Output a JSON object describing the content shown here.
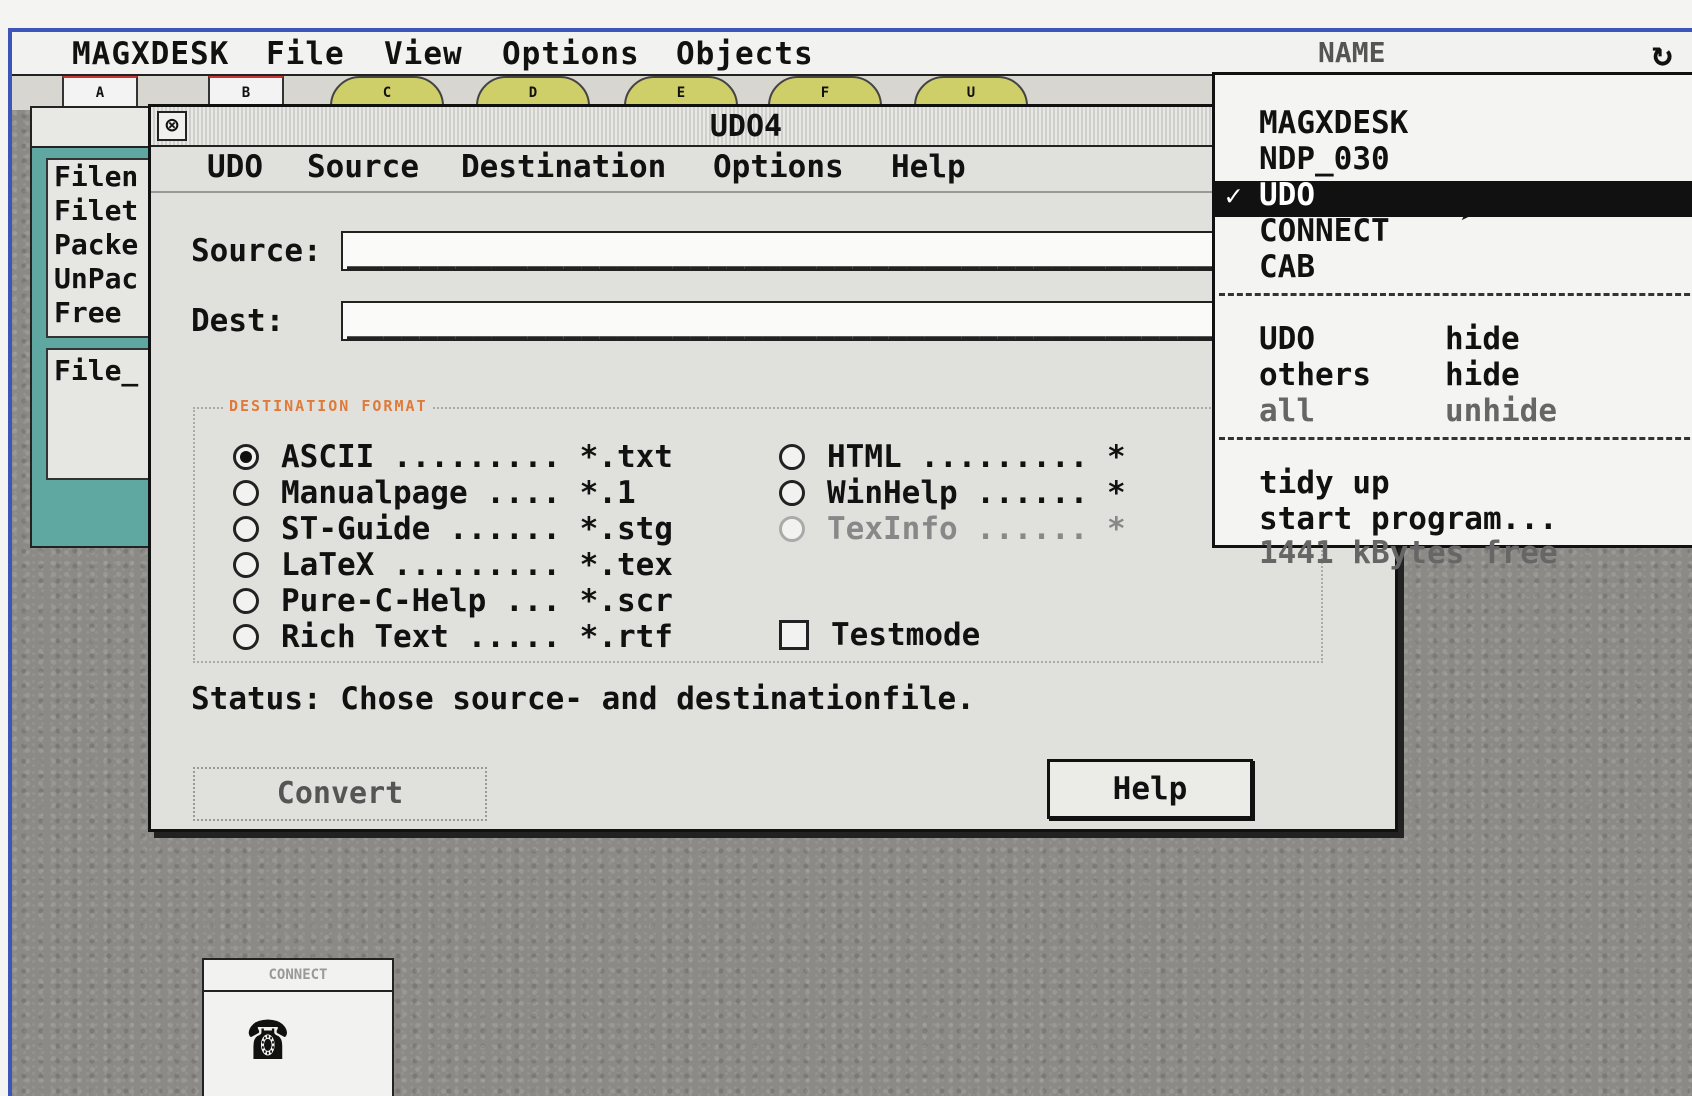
{
  "menubar": {
    "items": [
      "MAGXDESK",
      "File",
      "View",
      "Options",
      "Objects"
    ],
    "app_name": "NAME",
    "refresh_icon": "refresh-icon"
  },
  "drives": [
    "A",
    "B",
    "C",
    "D",
    "E",
    "F",
    "U"
  ],
  "bg_window": {
    "lines": [
      "Filen",
      "Filet",
      "Packe",
      "UnPac",
      "Free"
    ],
    "bottom_line": "File_"
  },
  "dialog": {
    "title": "UDO4",
    "menu": [
      "UDO",
      "Source",
      "Destination",
      "Options",
      "Help"
    ],
    "source_label": "Source:",
    "source_value": "________________________________________________",
    "dest_label": "Dest:",
    "dest_value": "________________________________________________",
    "format_group_title": "DESTINATION FORMAT",
    "formats_left": [
      "ASCII ......... *.txt",
      "Manualpage .... *.1",
      "ST-Guide ...... *.stg",
      "LaTeX ......... *.tex",
      "Pure-C-Help ... *.scr",
      "Rich Text ..... *.rtf"
    ],
    "formats_right": [
      "HTML ......... *",
      "WinHelp ...... *",
      "TexInfo ...... *"
    ],
    "selected_format": "ASCII",
    "testmode_label": "Testmode",
    "status": "Status: Chose source- and destinationfile.",
    "convert_button": "Convert",
    "help_button": "Help"
  },
  "dropdown": {
    "apps": [
      "MAGXDESK",
      "NDP_030",
      "UDO",
      "CONNECT",
      "CAB"
    ],
    "selected_app": "UDO",
    "check_mark": "✓",
    "visibility": [
      {
        "target": "UDO",
        "action": "hide"
      },
      {
        "target": "others",
        "action": "hide"
      },
      {
        "target": "all",
        "action": "unhide"
      }
    ],
    "commands": [
      "tidy up",
      "start program..."
    ],
    "free_memory": "1441 kBytes free"
  },
  "connect_window": {
    "title": "CONNECT",
    "icon": "telephone-icon"
  }
}
